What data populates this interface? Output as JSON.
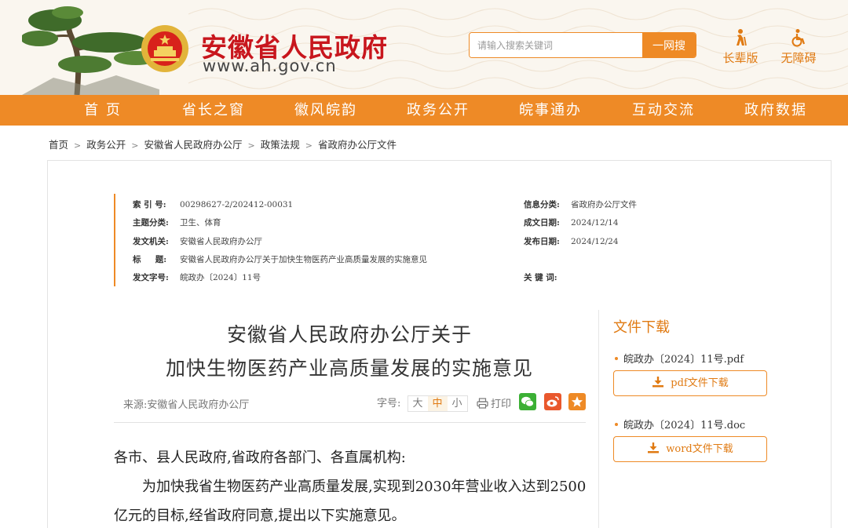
{
  "header": {
    "site_title": "安徽省人民政府",
    "site_url": "www.ah.gov.cn",
    "search_placeholder": "请输入搜索关键词",
    "search_button": "一网搜",
    "elder_mode": "长辈版",
    "accessibility": "无障碍"
  },
  "nav": {
    "items": [
      "首 页",
      "省长之窗",
      "徽风皖韵",
      "政务公开",
      "皖事通办",
      "互动交流",
      "政府数据"
    ],
    "active": "政务公开"
  },
  "breadcrumb": [
    "首页",
    "政务公开",
    "安徽省人民政府办公厅",
    "政策法规",
    "省政府办公厅文件"
  ],
  "meta": {
    "index_label": "索 引 号:",
    "index_value": "00298627-2/202412-00031",
    "topic_label": "主题分类:",
    "topic_value": "卫生、体育",
    "issuer_label": "发文机关:",
    "issuer_value": "安徽省人民政府办公厅",
    "title_label": "标     题:",
    "title_value": "安徽省人民政府办公厅关于加快生物医药产业高质量发展的实施意见",
    "docno_label": "发文字号:",
    "docno_value": "皖政办〔2024〕11号",
    "category_label": "信息分类:",
    "category_value": "省政府办公厅文件",
    "created_label": "成文日期:",
    "created_value": "2024/12/14",
    "published_label": "发布日期:",
    "published_value": "2024/12/24",
    "keywords_label": "关 键 词:",
    "keywords_value": ""
  },
  "article": {
    "title_line1": "安徽省人民政府办公厅关于",
    "title_line2": "加快生物医药产业高质量发展的实施意见",
    "source": "来源:安徽省人民政府办公厅",
    "font_size_label": "字号:",
    "font_sizes": [
      "大",
      "中",
      "小"
    ],
    "print_label": "打印",
    "salutation": "各市、县人民政府,省政府各部门、各直属机构:",
    "paragraph1_line1": "为加快我省生物医药产业高质量发展,实现到2030年营业收入达到2500",
    "paragraph1_line2": "亿元的目标,经省政府同意,提出以下实施意见。"
  },
  "downloads": {
    "title": "文件下载",
    "files": [
      {
        "name": "皖政办〔2024〕11号.pdf",
        "button": "pdf文件下载"
      },
      {
        "name": "皖政办〔2024〕11号.doc",
        "button": "word文件下载"
      }
    ]
  },
  "colors": {
    "brand_orange": "#ee8a26",
    "title_red": "#c8161d"
  }
}
